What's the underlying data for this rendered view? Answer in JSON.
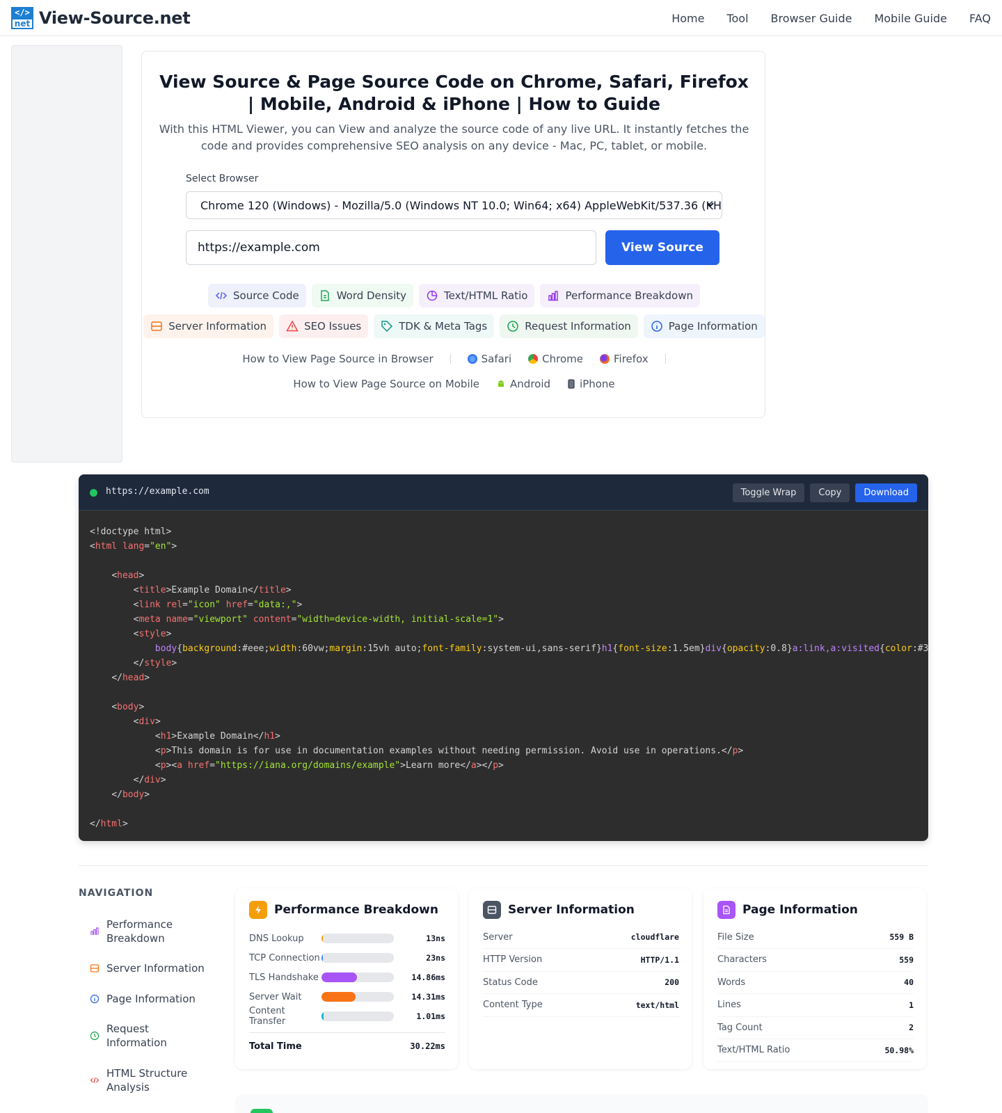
{
  "header": {
    "logo_top": "</>",
    "logo_bottom": "net",
    "logo_text": "View-Source.net",
    "nav": [
      "Home",
      "Tool",
      "Browser Guide",
      "Mobile Guide",
      "FAQ"
    ]
  },
  "hero": {
    "title": "View Source & Page Source Code on Chrome, Safari, Firefox | Mobile, Android & iPhone | How to Guide",
    "intro": "With this HTML Viewer, you can View and analyze the source code of any live URL. It instantly fetches the code and provides comprehensive SEO analysis on any device - Mac, PC, tablet, or mobile.",
    "select_label": "Select Browser",
    "select_value": "Chrome 120 (Windows) - Mozilla/5.0 (Windows NT 10.0; Win64; x64) AppleWebKit/537.36 (KH",
    "url_value": "https://example.com",
    "view_button": "View Source",
    "chips_row1": [
      "Source Code",
      "Word Density",
      "Text/HTML Ratio",
      "Performance Breakdown"
    ],
    "chips_row2": [
      "Server Information",
      "SEO Issues",
      "TDK & Meta Tags",
      "Request Information",
      "Page Information"
    ],
    "guide_browser_label": "How to View Page Source in Browser",
    "guide_browsers": [
      "Safari",
      "Chrome",
      "Firefox"
    ],
    "guide_mobile_label": "How to View Page Source on Mobile",
    "guide_mobile": [
      "Android",
      "iPhone"
    ]
  },
  "code_panel": {
    "url": "https://example.com",
    "toggle_wrap": "Toggle Wrap",
    "copy": "Copy",
    "download": "Download"
  },
  "navigation": {
    "title": "NAVIGATION",
    "items": [
      "Performance Breakdown",
      "Server Information",
      "Page Information",
      "Request Information",
      "HTML Structure Analysis"
    ]
  },
  "performance": {
    "title": "Performance Breakdown",
    "rows": [
      {
        "label": "DNS Lookup",
        "value": "13ns",
        "fraction": 0.0,
        "color": "#f59e0b"
      },
      {
        "label": "TCP Connection",
        "value": "23ns",
        "fraction": 0.01,
        "color": "#3b82f6"
      },
      {
        "label": "TLS Handshake",
        "value": "14.86ms",
        "fraction": 0.49,
        "color": "#a855f7"
      },
      {
        "label": "Server Wait",
        "value": "14.31ms",
        "fraction": 0.47,
        "color": "#f97316"
      },
      {
        "label": "Content Transfer",
        "value": "1.01ms",
        "fraction": 0.03,
        "color": "#06b6d4"
      }
    ],
    "total_label": "Total Time",
    "total_value": "30.22ms"
  },
  "server": {
    "title": "Server Information",
    "rows": [
      {
        "label": "Server",
        "value": "cloudflare"
      },
      {
        "label": "HTTP Version",
        "value": "HTTP/1.1"
      },
      {
        "label": "Status Code",
        "value": "200"
      },
      {
        "label": "Content Type",
        "value": "text/html"
      }
    ]
  },
  "page_info": {
    "title": "Page Information",
    "rows": [
      {
        "label": "File Size",
        "value": "559 B"
      },
      {
        "label": "Characters",
        "value": "559"
      },
      {
        "label": "Words",
        "value": "40"
      },
      {
        "label": "Lines",
        "value": "1"
      },
      {
        "label": "Tag Count",
        "value": "2"
      },
      {
        "label": "Text/HTML Ratio",
        "value": "50.98%"
      }
    ]
  },
  "colors": {
    "primary": "#2563eb",
    "code_bg": "#2d2d2d",
    "code_bar": "#1e293b"
  }
}
